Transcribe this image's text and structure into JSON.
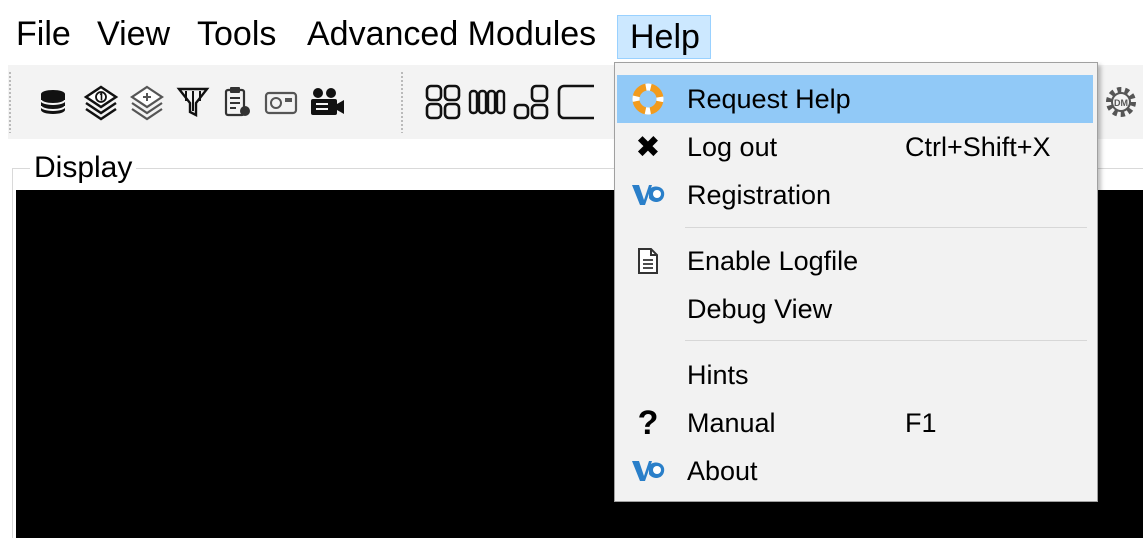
{
  "menubar": {
    "items": [
      {
        "label": "File"
      },
      {
        "label": "View"
      },
      {
        "label": "Tools"
      },
      {
        "label": "Advanced Modules"
      },
      {
        "label": "Help",
        "open": true
      }
    ]
  },
  "toolbar": {
    "icons": [
      "database-icon",
      "layers-number-icon",
      "layers-plus-icon",
      "filter-icon",
      "clipboard-icon",
      "camera-icon",
      "video-camera-icon",
      "grid-2x2-icon",
      "grid-columns-icon",
      "grid-mixed-icon",
      "single-view-icon",
      "settings-dm-icon"
    ]
  },
  "display": {
    "label": "Display",
    "background": "#000000"
  },
  "help_menu": {
    "items": [
      {
        "label": "Request Help",
        "shortcut": "",
        "icon": "lifebuoy-icon",
        "highlighted": true
      },
      {
        "label": "Log out",
        "shortcut": "Ctrl+Shift+X",
        "icon": "close-x-icon"
      },
      {
        "label": "Registration",
        "shortcut": "",
        "icon": "vq-logo-icon"
      },
      {
        "label": "Enable Logfile",
        "shortcut": "",
        "icon": "document-icon"
      },
      {
        "label": "Debug View",
        "shortcut": "",
        "icon": ""
      },
      {
        "label": "Hints",
        "shortcut": "",
        "icon": ""
      },
      {
        "label": "Manual",
        "shortcut": "F1",
        "icon": "question-mark-icon"
      },
      {
        "label": "About",
        "shortcut": "",
        "icon": "vq-logo-icon"
      }
    ],
    "highlight_color": "#91c9f7"
  }
}
